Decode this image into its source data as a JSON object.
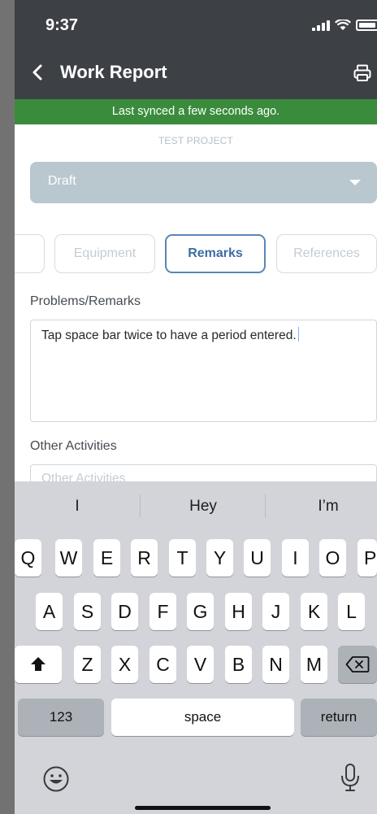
{
  "status_bar": {
    "time": "9:37"
  },
  "nav": {
    "title": "Work Report"
  },
  "sync": {
    "message": "Last synced a few seconds ago."
  },
  "project": {
    "name": "TEST PROJECT"
  },
  "status_select": {
    "value": "Draft"
  },
  "tabs": [
    {
      "label": ""
    },
    {
      "label": "Equipment"
    },
    {
      "label": "Remarks",
      "active": true
    },
    {
      "label": "References"
    }
  ],
  "remarks": {
    "label": "Problems/Remarks",
    "value": "Tap space bar twice to have a period entered."
  },
  "other_activities": {
    "label": "Other Activities",
    "placeholder": "Other Activities"
  },
  "keyboard": {
    "suggestions": [
      "I",
      "Hey",
      "I’m"
    ],
    "row1": [
      "Q",
      "W",
      "E",
      "R",
      "T",
      "Y",
      "U",
      "I",
      "O",
      "P"
    ],
    "row2": [
      "A",
      "S",
      "D",
      "F",
      "G",
      "H",
      "J",
      "K",
      "L"
    ],
    "row3": [
      "Z",
      "X",
      "C",
      "V",
      "B",
      "N",
      "M"
    ],
    "numbers_key": "123",
    "space_key": "space",
    "return_key": "return"
  },
  "colors": {
    "header": "#3d4145",
    "sync_bar": "#3a8c3c",
    "active_tab": "#3c6ea4",
    "select_bg": "#b9c7cf"
  }
}
